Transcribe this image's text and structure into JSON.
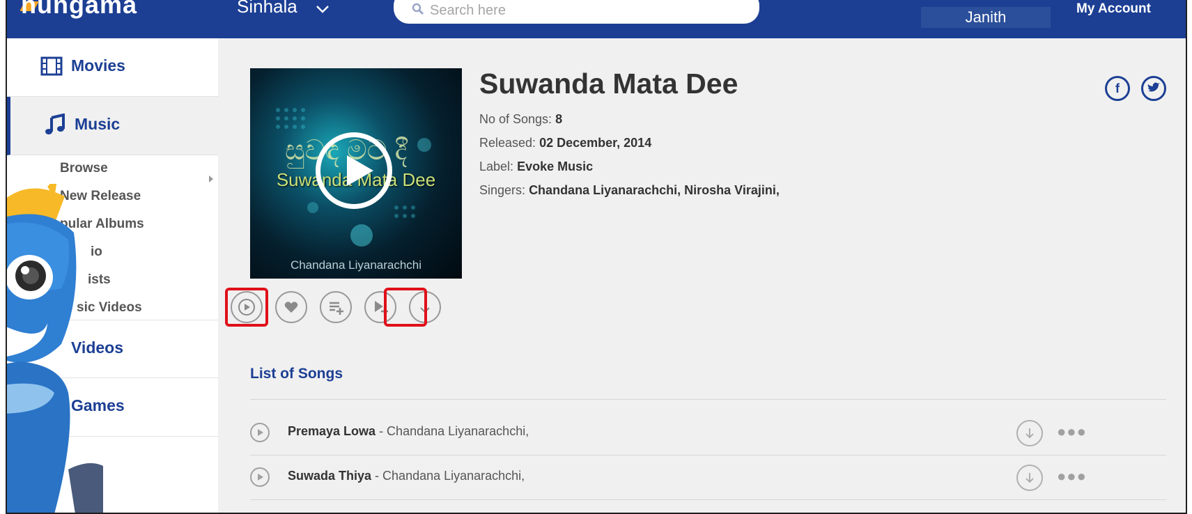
{
  "header": {
    "logo": "hungama",
    "language": "Sinhala",
    "search_placeholder": "Search here",
    "user": "Janith",
    "account": "My Account"
  },
  "sidebar": {
    "items": [
      {
        "label": "Movies",
        "icon": "film-icon"
      },
      {
        "label": "Music",
        "icon": "music-note-icon",
        "active": true
      },
      {
        "label": "Videos",
        "icon": "video-icon"
      },
      {
        "label": "Games",
        "icon": "gamepad-icon"
      }
    ],
    "music_sub": [
      "Browse",
      "New Release",
      "pular Albums",
      "io",
      "ists",
      "sic Videos"
    ]
  },
  "album": {
    "title": "Suwanda Mata Dee",
    "cover_title": "Suwanda Mata Dee",
    "cover_script": "සුවඳ මට දී",
    "cover_artist": "Chandana Liyanarachchi",
    "songs_label": "No of Songs:",
    "songs_count": "8",
    "released_label": "Released:",
    "released": "02 December, 2014",
    "label_label": "Label:",
    "label": "Evoke Music",
    "singers_label": "Singers:",
    "singers": "Chandana Liyanarachchi, Nirosha Virajini,"
  },
  "social": {
    "facebook": "f",
    "twitter": "t"
  },
  "list_heading": "List of Songs",
  "songs": [
    {
      "name": "Premaya Lowa",
      "artist": " - Chandana Liyanarachchi,"
    },
    {
      "name": "Suwada Thiya",
      "artist": " - Chandana Liyanarachchi,"
    }
  ],
  "colors": {
    "brand": "#1c3f94",
    "highlight": "#e01019",
    "background": "#f0f0f0"
  }
}
